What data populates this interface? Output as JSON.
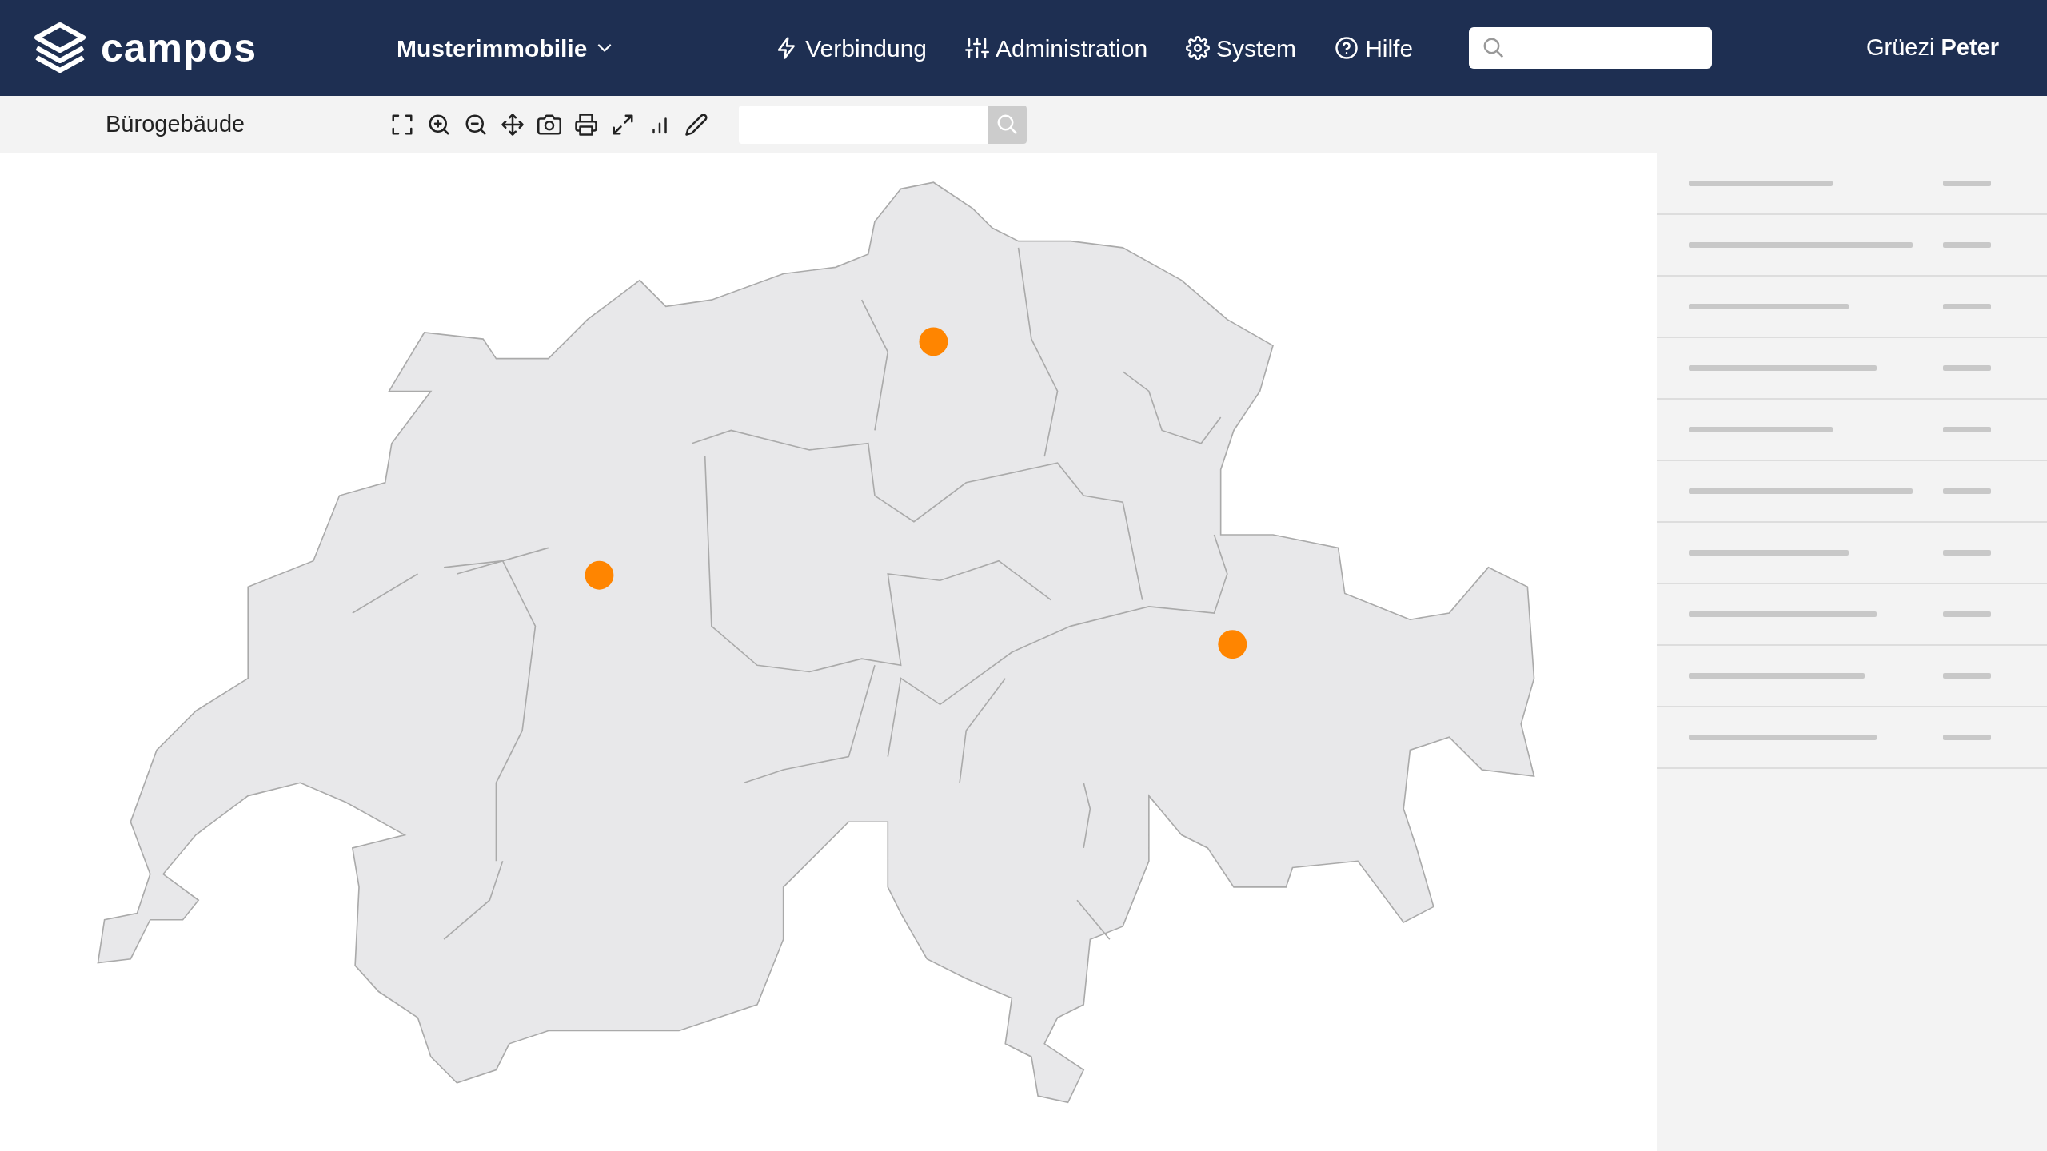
{
  "header": {
    "logo": "campos",
    "property_menu": "Musterimmobilie",
    "nav": [
      {
        "kind": "bolt",
        "label": "Verbindung"
      },
      {
        "kind": "sliders",
        "label": "Administration"
      },
      {
        "kind": "gear",
        "label": "System"
      },
      {
        "kind": "help",
        "label": "Hilfe"
      }
    ],
    "greeting": "Grüezi **Peter**"
  },
  "toolbar": {
    "title": "Bürogebäude",
    "tools": [
      {
        "kind": "frame"
      },
      {
        "kind": "zoom-in"
      },
      {
        "kind": "zoom-out"
      },
      {
        "kind": "move"
      },
      {
        "kind": "camera"
      },
      {
        "kind": "print"
      },
      {
        "kind": "expand"
      },
      {
        "kind": "chart"
      },
      {
        "kind": "pencil"
      }
    ]
  }
}
